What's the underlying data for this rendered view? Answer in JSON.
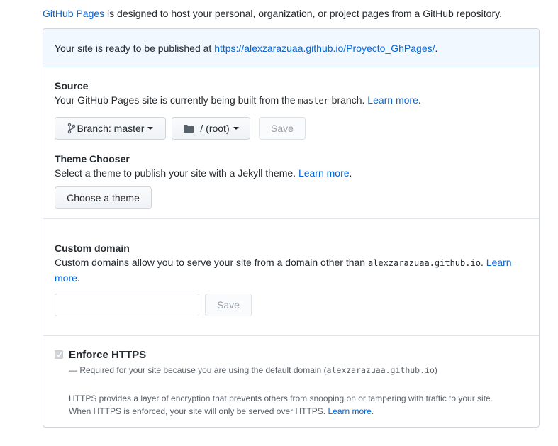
{
  "intro": {
    "link_text": "GitHub Pages",
    "text": " is designed to host your personal, organization, or project pages from a GitHub repository."
  },
  "flash": {
    "text": "Your site is ready to be published at ",
    "url": "https://alexzarazuaa.github.io/Proyecto_GhPages/",
    "suffix": "."
  },
  "source": {
    "title": "Source",
    "desc_before": "Your GitHub Pages site is currently being built from the ",
    "branch_code": "master",
    "desc_after": " branch. ",
    "learn_more": "Learn more",
    "period": ".",
    "branch_button": "Branch: master",
    "folder_button": "/ (root)",
    "save_button": "Save"
  },
  "theme": {
    "title": "Theme Chooser",
    "desc": "Select a theme to publish your site with a Jekyll theme. ",
    "learn_more": "Learn more",
    "period": ".",
    "button": "Choose a theme"
  },
  "domain": {
    "title": "Custom domain",
    "desc_before": "Custom domains allow you to serve your site from a domain other than ",
    "domain_code": "alexzarazuaa.github.io",
    "desc_after": ". ",
    "learn_more": "Learn more",
    "period": ".",
    "input_value": "",
    "save_button": "Save"
  },
  "https": {
    "title": "Enforce HTTPS",
    "checked": true,
    "required_before": "— Required for your site because you are using the default domain (",
    "required_code": "alexzarazuaa.github.io",
    "required_after": ")",
    "desc_line1": "HTTPS provides a layer of encryption that prevents others from snooping on or tampering with traffic to your site.",
    "desc_line2": "When HTTPS is enforced, your site will only be served over HTTPS. ",
    "learn_more": "Learn more",
    "period": "."
  },
  "colors": {
    "link": "#0366d6",
    "flash_bg": "#f1f8ff",
    "border": "#d1d5da"
  },
  "icons": {
    "branch": "git-branch-icon",
    "folder": "folder-icon",
    "caret": "caret-down-icon",
    "check": "check-icon"
  }
}
